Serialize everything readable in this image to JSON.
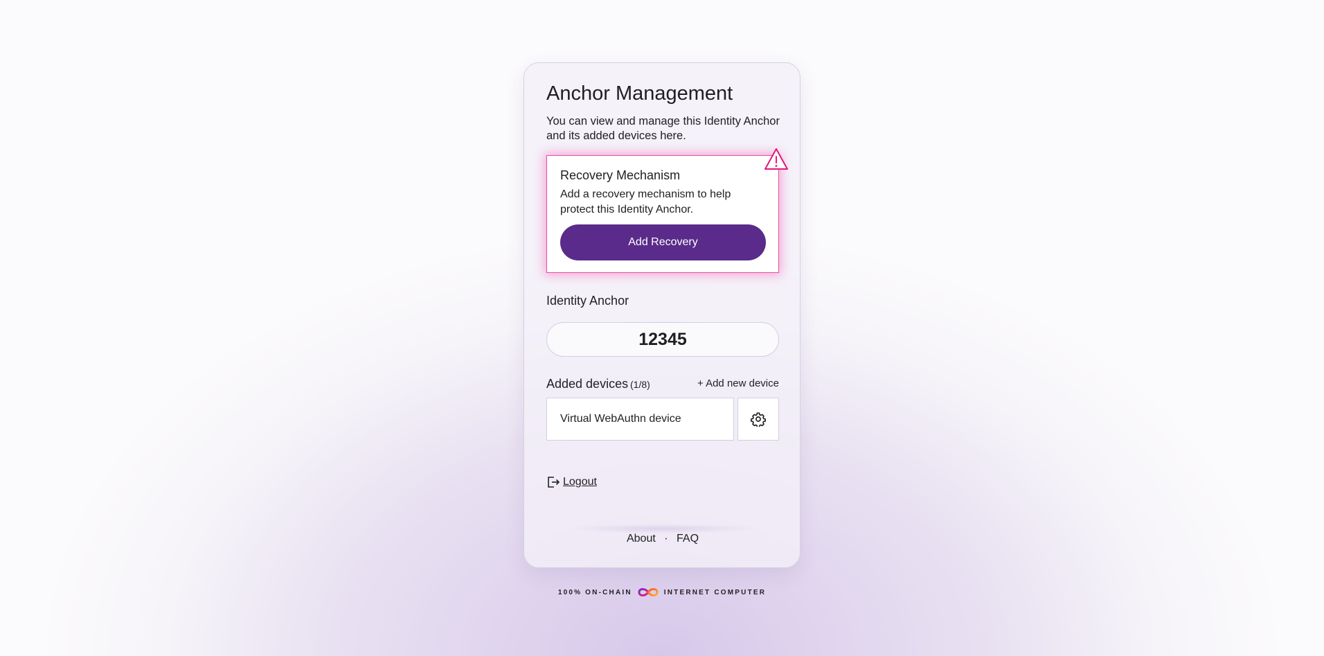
{
  "page": {
    "title": "Anchor Management",
    "intro": "You can view and manage this Identity Anchor and its added devices here."
  },
  "recovery": {
    "title": "Recovery Mechanism",
    "text": "Add a recovery mechanism to help protect this Identity Anchor.",
    "button_label": "Add Recovery",
    "warning_icon": "warning-triangle-icon",
    "accent_color": "#e5157a"
  },
  "anchor": {
    "label": "Identity Anchor",
    "number": "12345"
  },
  "devices": {
    "title": "Added devices",
    "count": "(1/8)",
    "add_label": "+ Add new device",
    "items": [
      {
        "name": "Virtual WebAuthn device",
        "settings_icon": "gear-icon"
      }
    ]
  },
  "logout": {
    "label": "Logout",
    "icon": "logout-icon"
  },
  "footer": {
    "about": "About",
    "separator": "·",
    "faq": "FAQ"
  },
  "brand": {
    "left": "100% ON-CHAIN",
    "right": "INTERNET COMPUTER",
    "logo": "infinity-logo-icon"
  },
  "colors": {
    "primary_button": "#5a2b8a",
    "warning": "#e5157a"
  }
}
